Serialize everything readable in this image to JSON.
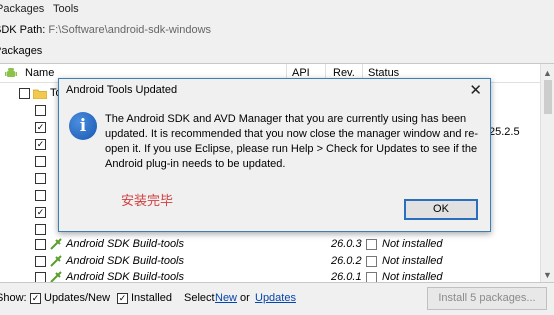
{
  "menu": {
    "packages": "Packages",
    "tools": "Tools"
  },
  "sdk_path": {
    "label": "SDK Path:",
    "value": "F:\\Software\\android-sdk-windows"
  },
  "packages_section": {
    "label": "Packages"
  },
  "table": {
    "columns": {
      "name": "Name",
      "api": "API",
      "rev": "Rev.",
      "status": "Status"
    },
    "partial_group_label": "To",
    "partial_rev": "25.2.5",
    "rows": [
      {
        "name": "Android SDK Build-tools",
        "rev": "26.0.3",
        "status": "Not installed"
      },
      {
        "name": "Android SDK Build-tools",
        "rev": "26.0.2",
        "status": "Not installed"
      },
      {
        "name": "Android SDK Build-tools",
        "rev": "26.0.1",
        "status": "Not installed"
      }
    ]
  },
  "bottom": {
    "show_label": "Show:",
    "updates_new": "Updates/New",
    "installed": "Installed",
    "select_label": "Select",
    "new_link": "New",
    "or_label": "or",
    "updates_link": "Updates",
    "install_button": "Install 5 packages..."
  },
  "dialog": {
    "title": "Android Tools Updated",
    "message": "The Android SDK and AVD Manager that you are currently using has been updated. It is recommended that you now close the manager window and re-open it. If you use Eclipse, please run Help > Check for Updates to see if the Android plug-in needs to be updated.",
    "note": "安装完毕",
    "ok_button": "OK",
    "icon": "info-icon"
  }
}
